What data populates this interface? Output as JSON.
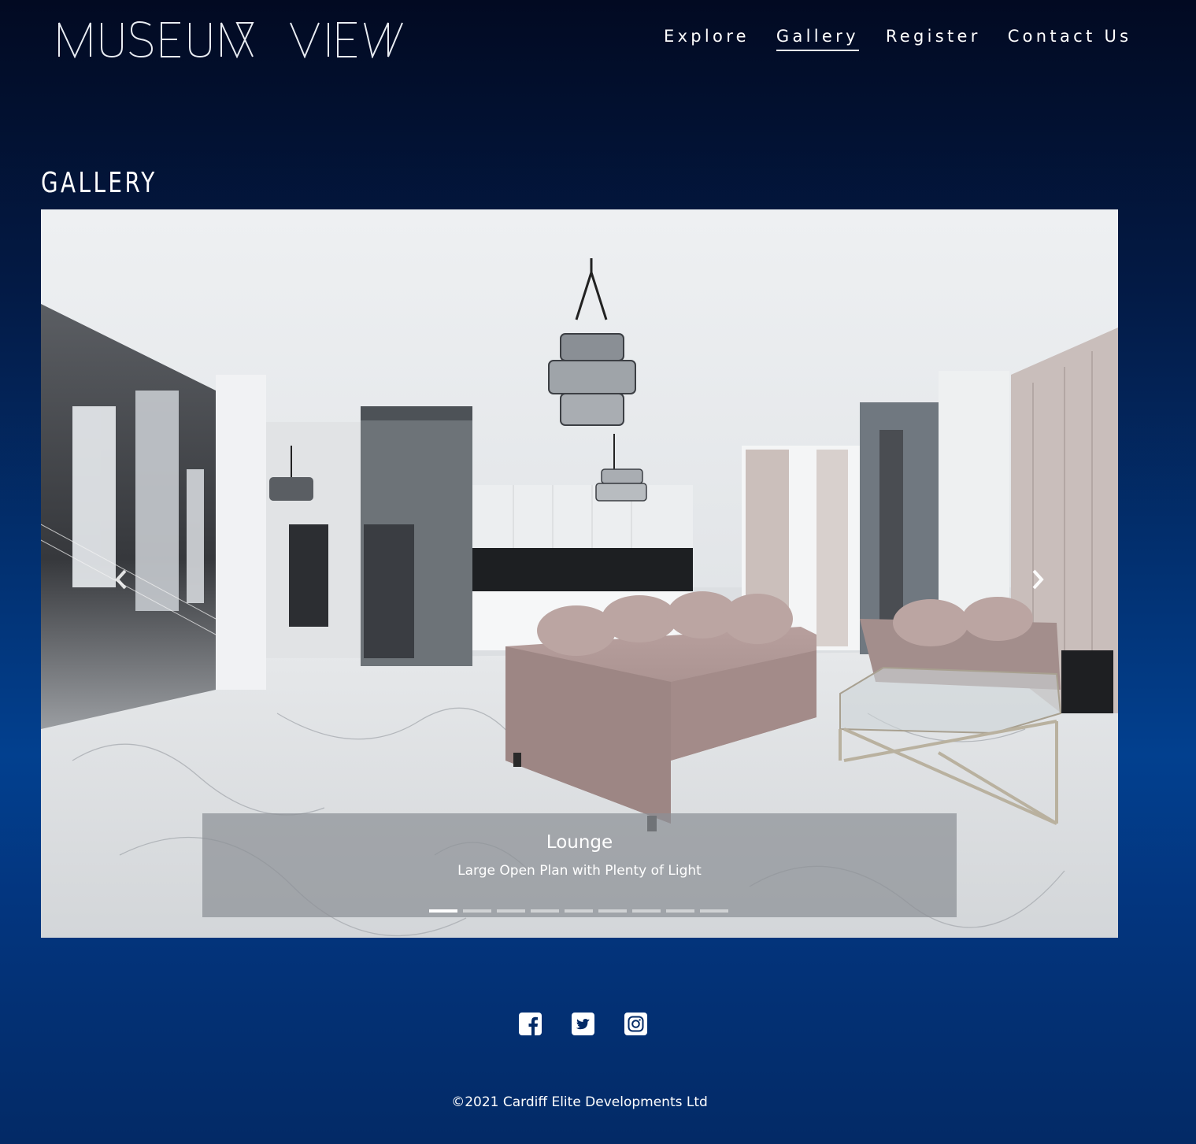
{
  "header": {
    "logo_text": "MUSEUM VIEW",
    "nav": [
      {
        "label": "Explore",
        "active": false
      },
      {
        "label": "Gallery",
        "active": true
      },
      {
        "label": "Register",
        "active": false
      },
      {
        "label": "Contact Us",
        "active": false
      }
    ]
  },
  "main": {
    "title": "GALLERY",
    "carousel": {
      "slide": {
        "title": "Lounge",
        "subtitle": "Large Open Plan with Plenty of Light"
      },
      "indicator_count": 9,
      "active_index": 0,
      "prev_icon": "chevron-left-icon",
      "next_icon": "chevron-right-icon"
    }
  },
  "footer": {
    "social_icons": [
      "facebook-icon",
      "twitter-icon",
      "instagram-icon"
    ],
    "copyright": "©2021 Cardiff Elite Developments Ltd"
  },
  "colors": {
    "background_top": "#020a22",
    "background_mid": "#02408f",
    "text": "#ffffff"
  }
}
